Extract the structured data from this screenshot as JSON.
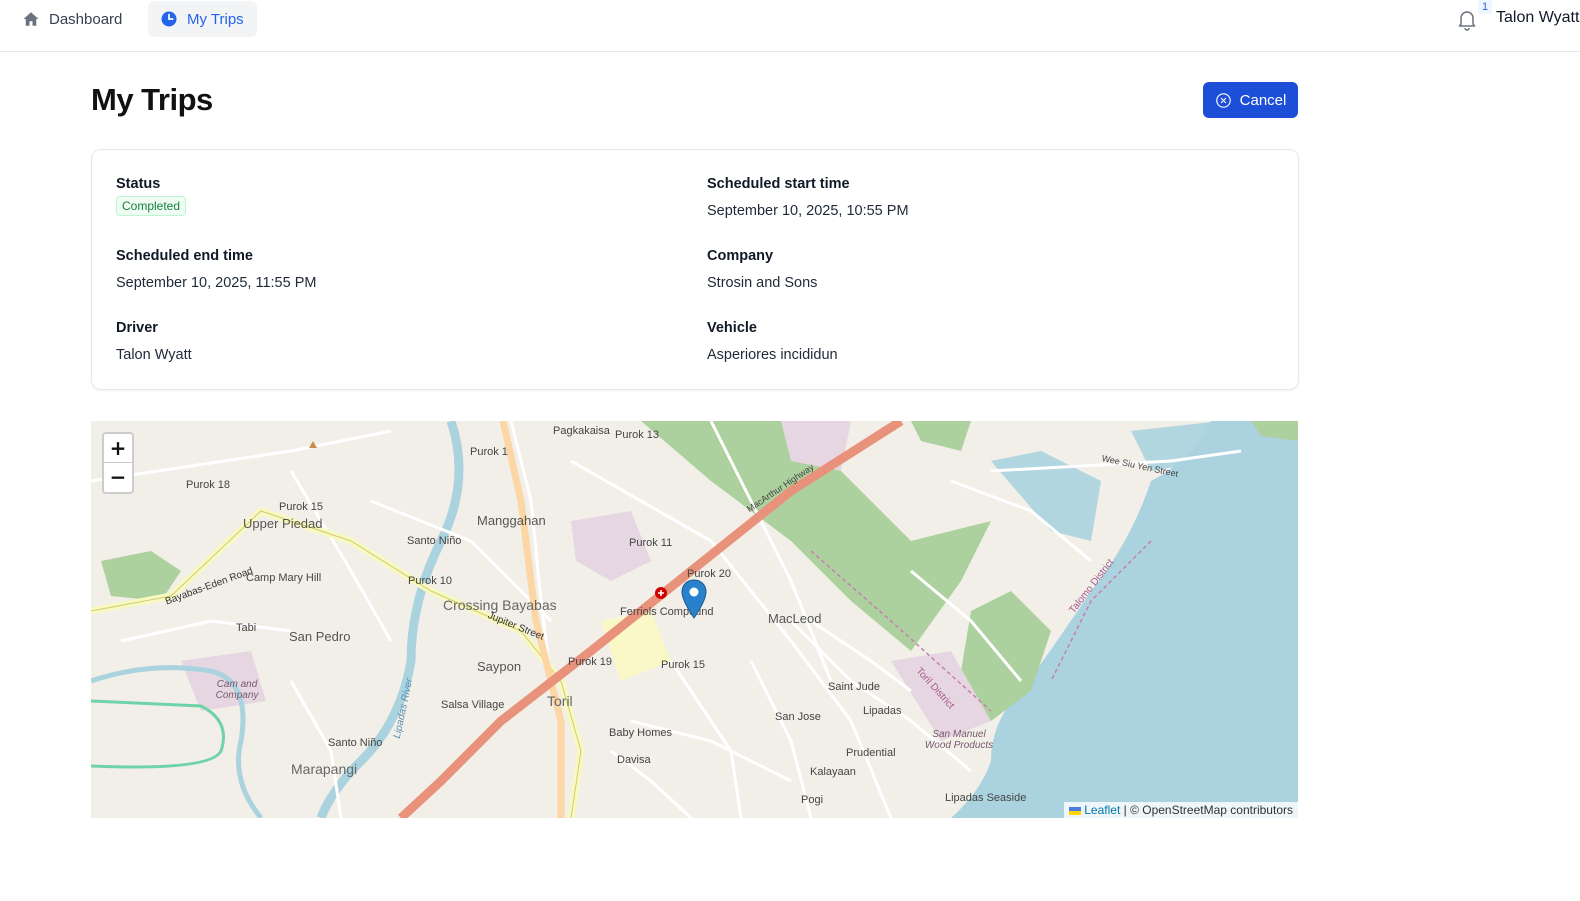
{
  "nav": {
    "dashboard_label": "Dashboard",
    "my_trips_label": "My Trips",
    "notification_count": "1",
    "user_name": "Talon Wyatt"
  },
  "page": {
    "title": "My Trips",
    "cancel_label": "Cancel"
  },
  "trip": {
    "status_label": "Status",
    "status_value": "Completed",
    "start_label": "Scheduled start time",
    "start_value": "September 10, 2025, 10:55 PM",
    "end_label": "Scheduled end time",
    "end_value": "September 10, 2025, 11:55 PM",
    "company_label": "Company",
    "company_value": "Strosin and Sons",
    "driver_label": "Driver",
    "driver_value": "Talon Wyatt",
    "vehicle_label": "Vehicle",
    "vehicle_value": "Asperiores incididun"
  },
  "map": {
    "zoom_in": "+",
    "zoom_out": "−",
    "attribution_link": "Leaflet",
    "attribution_text": " | © OpenStreetMap contributors",
    "labels": {
      "toril": "Toril",
      "crossing_bayabas": "Crossing Bayabas",
      "manggahan": "Manggahan",
      "upper_piedad": "Upper Piedad",
      "san_pedro": "San Pedro",
      "marapangi": "Marapangi",
      "macleod": "MacLeod",
      "saypon": "Saypon",
      "santo_nino": "Santo Niño",
      "santo_nino_2": "Santo Niño",
      "purok_18": "Purok 18",
      "purok_15a": "Purok 15",
      "purok_10": "Purok 10",
      "purok_11": "Purok 11",
      "purok_20": "Purok 20",
      "purok_19": "Purok 19",
      "purok_15b": "Purok 15",
      "purok_1": "Purok 1",
      "purok_13": "Purok 13",
      "pagkakaisa": "Pagkakaisa",
      "ferriols": "Ferriols Compound",
      "camp_mary_hill": "Camp Mary Hill",
      "tabi": "Tabi",
      "salsa_village": "Salsa Village",
      "baby_homes": "Baby Homes",
      "davisa": "Davisa",
      "saint_jude": "Saint Jude",
      "san_jose": "San Jose",
      "lipadas": "Lipadas",
      "prudential": "Prudential",
      "kalayaan": "Kalayaan",
      "pogi": "Pogi",
      "lipadas_seaside": "Lipadas Seaside",
      "san_manuel": "San Manuel Wood Products",
      "wee_siu_yen": "Wee Siu Yen Street",
      "macarthur": "MacArthur Highway",
      "jupiter": "Jupiter Street",
      "talomo": "Talomo District",
      "toril_district": "Toril District",
      "bayabas_eden": "Bayabas-Eden Road",
      "lipadas_river": "Lipadas River",
      "cam_company": "Cam and Company"
    }
  },
  "colors": {
    "accent": "#1d4ed8",
    "status_green": "#15803d",
    "sea": "#aad3df",
    "park": "#add19e",
    "highway": "#e8927c"
  }
}
